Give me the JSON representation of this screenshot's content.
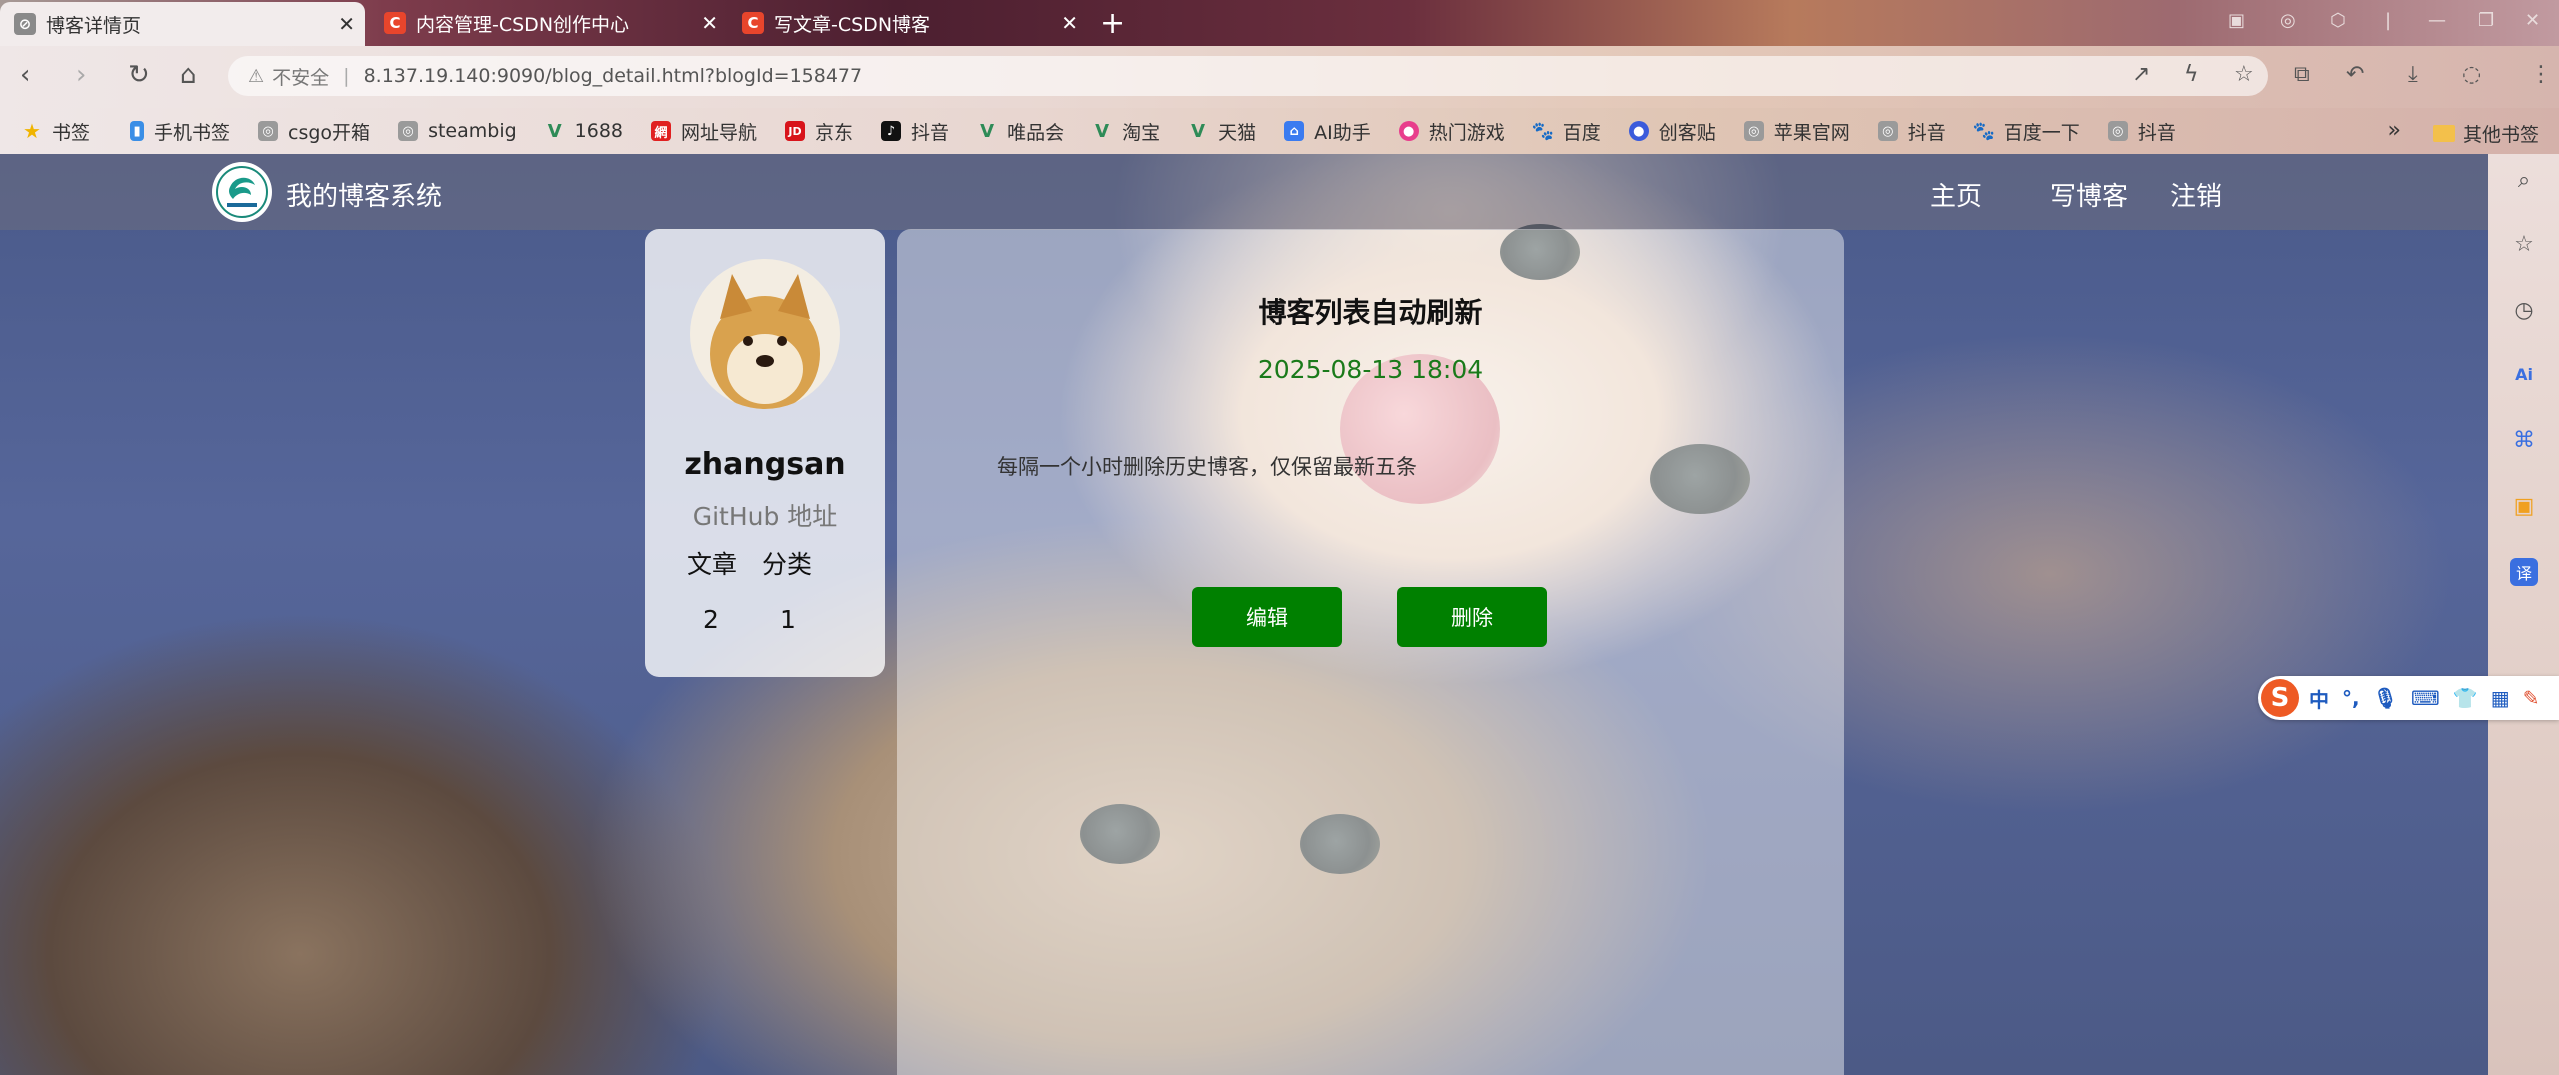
{
  "browser": {
    "tabs": [
      {
        "title": "博客详情页",
        "active": true
      },
      {
        "title": "内容管理-CSDN创作中心",
        "active": false
      },
      {
        "title": "写文章-CSDN博客",
        "active": false
      }
    ],
    "address": {
      "security_label": "不安全",
      "url": "8.137.19.140:9090/blog_detail.html?blogId=158477"
    },
    "bookmarks": [
      "书签",
      "手机书签",
      "csgo开箱",
      "steambig",
      "1688",
      "网址导航",
      "京东",
      "抖音",
      "唯品会",
      "淘宝",
      "天猫",
      "AI助手",
      "热门游戏",
      "百度",
      "创客贴",
      "苹果官网",
      "抖音",
      "百度一下",
      "抖音"
    ],
    "bookmarks_more": "»",
    "other_bookmarks": "其他书签"
  },
  "site": {
    "title": "我的博客系统",
    "nav": {
      "home": "主页",
      "write": "写博客",
      "logout": "注销"
    }
  },
  "profile": {
    "username": "zhangsan",
    "github_label": "GitHub 地址",
    "articles_label": "文章",
    "categories_label": "分类",
    "articles_count": "2",
    "categories_count": "1"
  },
  "blog": {
    "title": "博客列表自动刷新",
    "date": "2025-08-13 18:04",
    "content": "每隔一个小时删除历史博客，仅保留最新五条",
    "edit_label": "编辑",
    "delete_label": "删除"
  },
  "ime": {
    "lang": "中",
    "punct": "°,"
  },
  "colors": {
    "action_green": "#008000",
    "date_green": "#1a7a1a",
    "ime_orange": "#ee5a24"
  }
}
